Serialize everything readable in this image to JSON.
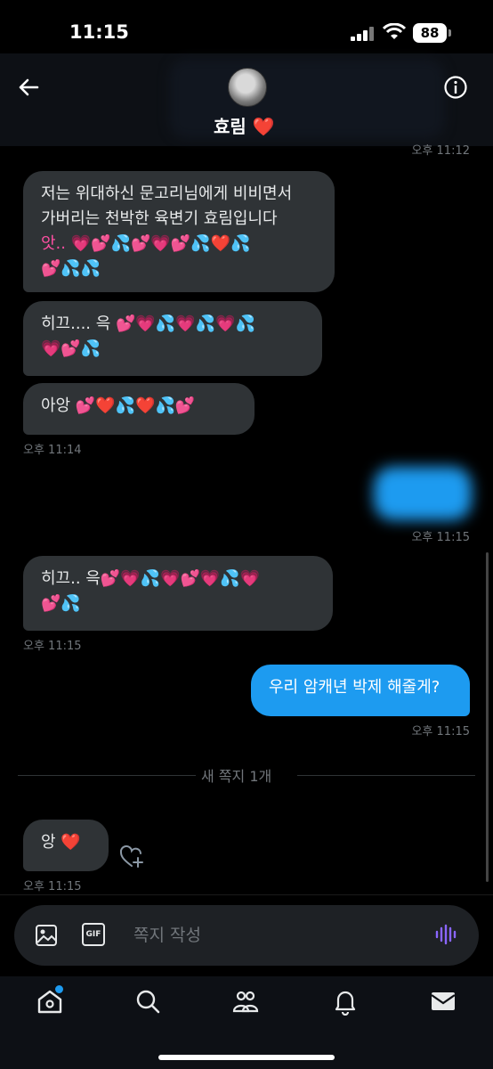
{
  "status_bar": {
    "time": "11:15",
    "battery": "88"
  },
  "header": {
    "contact_name": "효림",
    "contact_emoji": "❤️"
  },
  "conversation": {
    "top_timestamp": "오후 11:12",
    "messages": [
      {
        "side": "left",
        "lines": [
          "저는 위대하신 문고리님에게 비비면서",
          "가버리는 천박한 육변기 효림입니다",
          "앗.. 💗💕💦💕💗💕💦❤️💦",
          "💕💦💦"
        ]
      },
      {
        "side": "left",
        "lines": [
          "히끄.... 윽 💕💗💦💗💦💗💦",
          "💗💕💦"
        ]
      },
      {
        "side": "left",
        "lines": [
          "아앙 💕❤️💦❤️💦💕"
        ],
        "timestamp": "오후 11:14"
      },
      {
        "side": "right",
        "blurred": true,
        "timestamp": "오후 11:15"
      },
      {
        "side": "left",
        "lines": [
          "히끄.. 윽💕💗💦💗💕💗💦💗",
          "💕💦"
        ],
        "timestamp": "오후 11:15"
      },
      {
        "side": "right",
        "lines": [
          "우리 암캐년 박제 해줄게?"
        ],
        "timestamp": "오후 11:15"
      },
      {
        "side": "left",
        "lines": [
          "앙 ❤️"
        ],
        "timestamp": "오후 11:15"
      }
    ],
    "divider": "새 쪽지 1개"
  },
  "compose": {
    "placeholder": "쪽지 작성",
    "gif_label": "GIF"
  },
  "colors": {
    "accent": "#1d9bf0",
    "bubble_in": "#2f3336",
    "background": "#000000"
  },
  "tabs": [
    "home-icon",
    "search-icon",
    "communities-icon",
    "notifications-icon",
    "messages-icon"
  ]
}
